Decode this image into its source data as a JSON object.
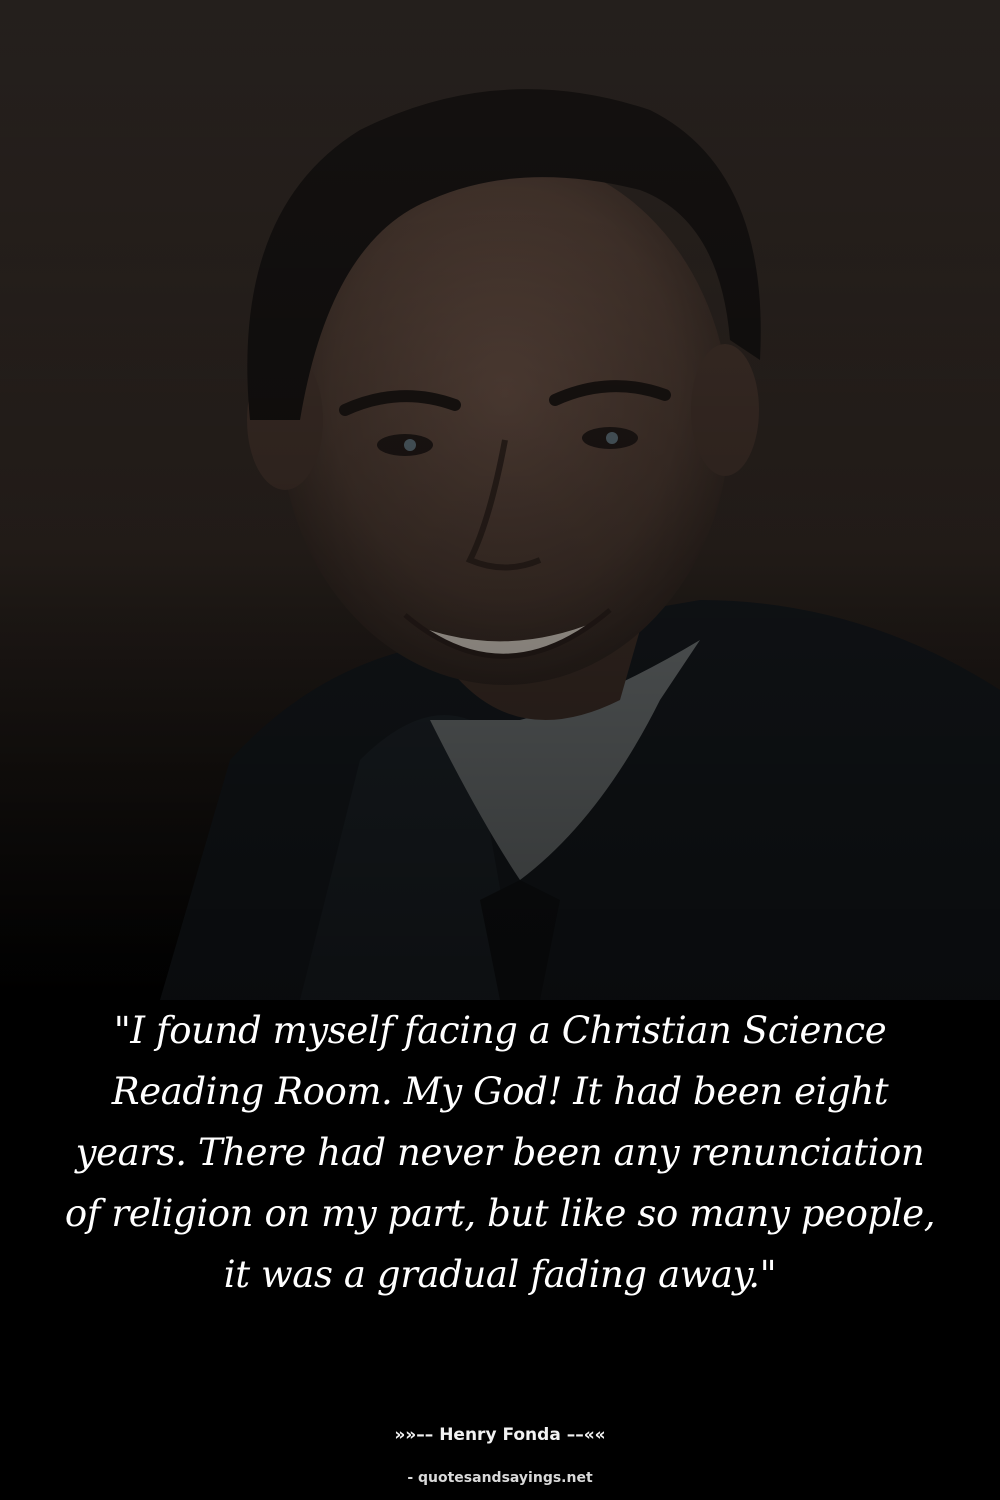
{
  "quote": {
    "text": "\"I found myself facing a Christian Science Reading Room. My God! It had been eight years. There had never been any renunciation of religion on my part, but like so many people, it was a gradual fading away.\""
  },
  "attribution": {
    "author_line": "»»–– Henry Fonda ––««"
  },
  "source": {
    "site": "- quotesandsayings.net"
  },
  "colors": {
    "background": "#000000",
    "text": "#ffffff",
    "photo_backdrop": "#2b241f"
  }
}
